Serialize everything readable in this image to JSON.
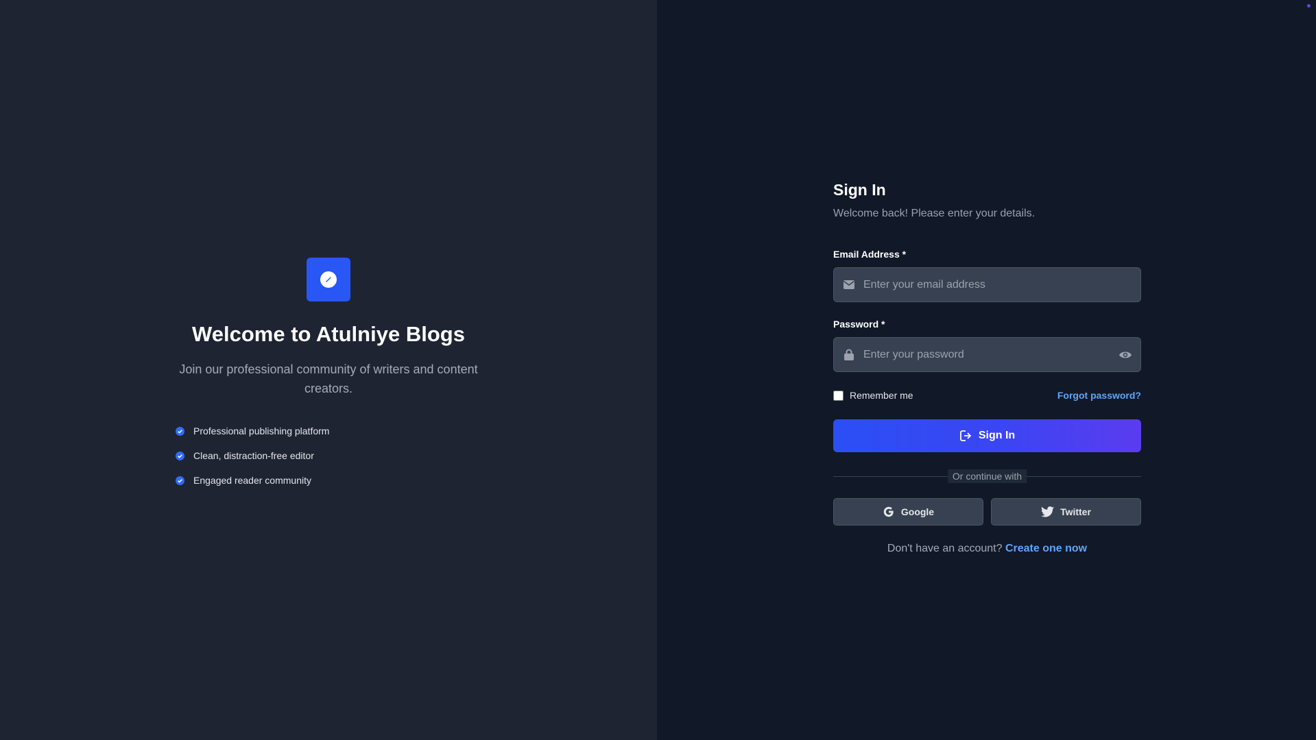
{
  "brand": {
    "logo_icon": "compass-icon",
    "accent_color": "#2957f5",
    "welcome_title": "Welcome to Atulniye Blogs",
    "tagline": "Join our professional community of writers and content creators.",
    "features": [
      "Professional publishing platform",
      "Clean, distraction-free editor",
      "Engaged reader community"
    ]
  },
  "signin": {
    "title": "Sign In",
    "subtitle": "Welcome back! Please enter your details.",
    "email_label": "Email Address *",
    "email_placeholder": "Enter your email address",
    "email_value": "",
    "password_label": "Password *",
    "password_placeholder": "Enter your password",
    "password_value": "",
    "remember_label": "Remember me",
    "remember_checked": false,
    "forgot_label": "Forgot password?",
    "submit_label": "Sign In",
    "divider_text": "Or continue with",
    "google_label": "Google",
    "twitter_label": "Twitter",
    "no_account_text": "Don't have an account? ",
    "create_label": "Create one now"
  }
}
